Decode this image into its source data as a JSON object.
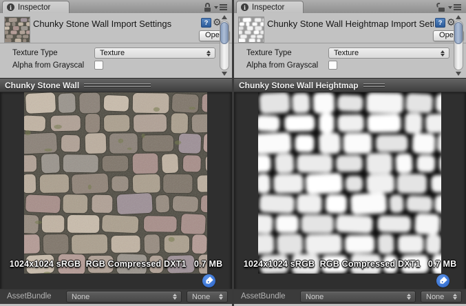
{
  "icons": {
    "info_glyph": "i",
    "help_glyph": "?",
    "gear_glyph": "⚙"
  },
  "colors": {
    "panel_bg": "#c2c2c2",
    "preview_bg": "#2f2f2f",
    "scroll_thumb_blue": "#8296b4",
    "tag_blue": "#2a63c8",
    "help_blue": "#2c5b99",
    "mortar_color": "#4d4a40",
    "heightmap_bg": "#101010"
  },
  "texture_palettes": {
    "color": [
      "#a2948a",
      "#b0a094",
      "#8f8276",
      "#bcae9e",
      "#a78d88",
      "#99938b",
      "#b49a94",
      "#8a8076",
      "#c1b3a2",
      "#9d8f96",
      "#ab9f8d",
      "#968a7e",
      "#7e7468",
      "#c9bcab"
    ],
    "heightmap": [
      "#ffffff",
      "#f5f5f5",
      "#ebebeb",
      "#fbfbfb",
      "#f0f0f0",
      "#e4e4e4"
    ],
    "moss": "#6f7544"
  },
  "panels": [
    {
      "tab_label": "Inspector",
      "lock_state": "locked",
      "title": "Chunky Stone Wall Import Settings",
      "open_button": "Open",
      "texture_type_label": "Texture Type",
      "texture_type_value": "Texture",
      "alpha_label": "Alpha from Grayscal",
      "preview_title": "Chunky Stone Wall",
      "preview_info": "1024x1024 sRGB  RGB Compressed DXT1   0.7 MB",
      "assetbundle_label": "AssetBundle",
      "bundle_value": "None",
      "bundle_variant_value": "None",
      "texture_variant": "color"
    },
    {
      "tab_label": "Inspector",
      "lock_state": "unlocked",
      "title": "Chunky Stone Wall Heightmap Import Settings",
      "open_button": "Open",
      "texture_type_label": "Texture Type",
      "texture_type_value": "Texture",
      "alpha_label": "Alpha from Grayscal",
      "preview_title": "Chunky Stone Wall Heightmap",
      "preview_info": "1024x1024 sRGB  RGB Compressed DXT1   0.7 MB",
      "assetbundle_label": "AssetBundle",
      "bundle_value": "None",
      "bundle_variant_value": "None",
      "texture_variant": "heightmap"
    }
  ]
}
